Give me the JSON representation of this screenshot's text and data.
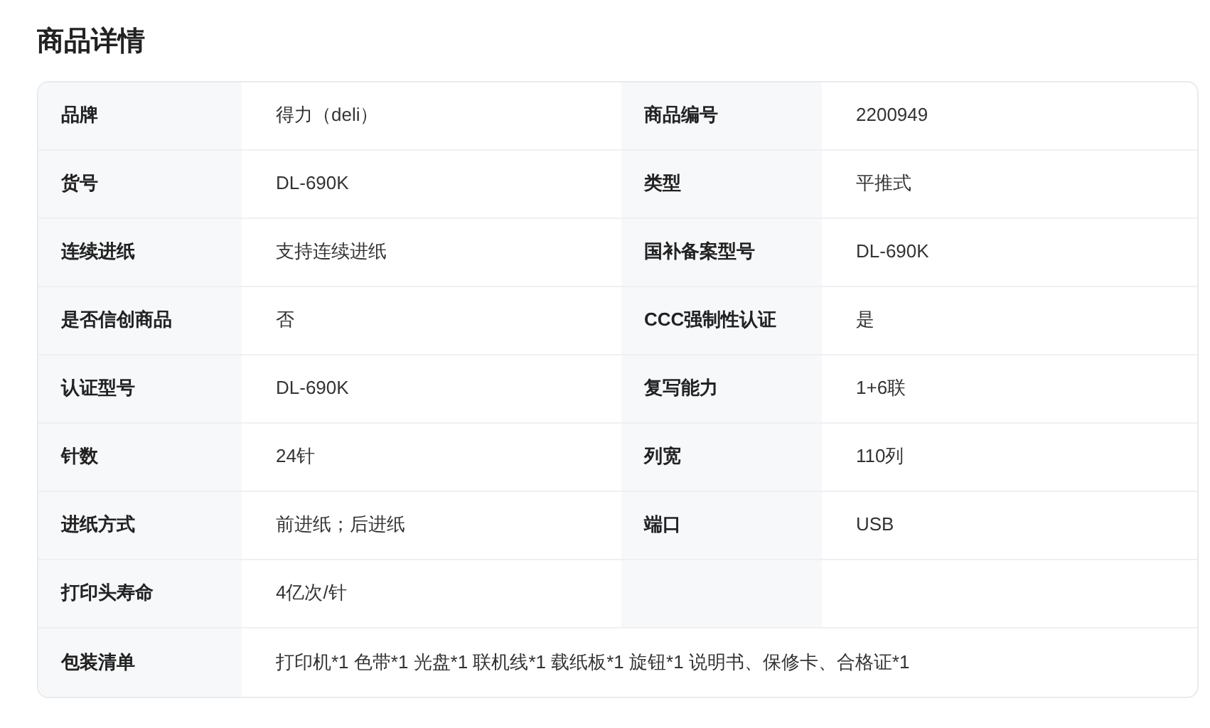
{
  "title": "商品详情",
  "rows": [
    {
      "kind": "pair",
      "cells": [
        {
          "label": "品牌",
          "value": "得力（deli）"
        },
        {
          "label": "商品编号",
          "value": "2200949"
        }
      ]
    },
    {
      "kind": "pair",
      "cells": [
        {
          "label": "货号",
          "value": "DL-690K"
        },
        {
          "label": "类型",
          "value": "平推式"
        }
      ]
    },
    {
      "kind": "pair",
      "cells": [
        {
          "label": "连续进纸",
          "value": "支持连续进纸"
        },
        {
          "label": "国补备案型号",
          "value": "DL-690K"
        }
      ]
    },
    {
      "kind": "pair",
      "cells": [
        {
          "label": "是否信创商品",
          "value": "否"
        },
        {
          "label": "CCC强制性认证",
          "value": "是"
        }
      ]
    },
    {
      "kind": "pair",
      "cells": [
        {
          "label": "认证型号",
          "value": "DL-690K"
        },
        {
          "label": "复写能力",
          "value": "1+6联"
        }
      ]
    },
    {
      "kind": "pair",
      "cells": [
        {
          "label": "针数",
          "value": "24针"
        },
        {
          "label": "列宽",
          "value": "110列"
        }
      ]
    },
    {
      "kind": "pair",
      "cells": [
        {
          "label": "进纸方式",
          "value": "前进纸；后进纸"
        },
        {
          "label": "端口",
          "value": "USB"
        }
      ]
    },
    {
      "kind": "pair",
      "cells": [
        {
          "label": "打印头寿命",
          "value": "4亿次/针"
        }
      ]
    },
    {
      "kind": "full",
      "cells": [
        {
          "label": "包装清单",
          "value": "打印机*1 色带*1 光盘*1 联机线*1 载纸板*1 旋钮*1 说明书、保修卡、合格证*1"
        }
      ]
    }
  ]
}
